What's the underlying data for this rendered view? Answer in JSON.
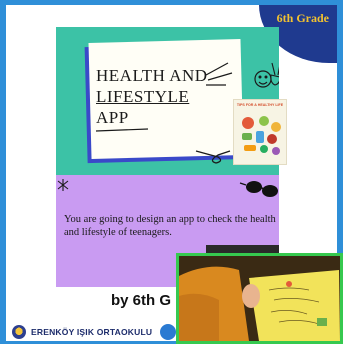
{
  "slide": {
    "grade_label": "6th Grade",
    "title_lines": [
      "HEALTH AND",
      "LIFESTYLE",
      "APP"
    ],
    "poster_title": "TIPS FOR A HEALTHY LIFE",
    "description": "You are going to design an app to check the health and lifestyle of teenagers.",
    "byline": "by 6th G",
    "school_name": "ERENKÖY IŞIK ORTAOKULU"
  },
  "colors": {
    "frame": "#2f8fd8",
    "teal": "#3cc2a6",
    "purple": "#c99bf2",
    "navy": "#1f3a8f",
    "gold": "#f2c230",
    "video_border": "#36c94f"
  },
  "video_overlay": {
    "icon": "camera-feed"
  }
}
